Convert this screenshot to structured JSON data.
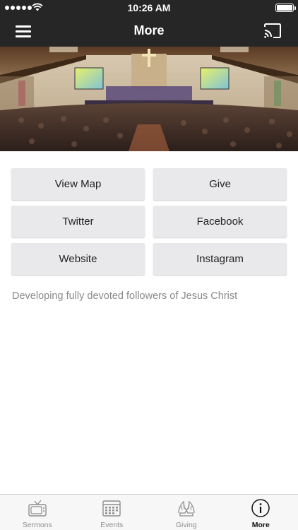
{
  "status_bar": {
    "time": "10:26 AM",
    "signal_icon": "signal-dots-icon",
    "wifi_icon": "wifi-icon",
    "battery_icon": "battery-icon"
  },
  "navbar": {
    "title": "More",
    "menu_icon": "hamburger-menu-icon",
    "cast_icon": "cast-icon"
  },
  "hero": {
    "image": "church-sanctuary-worship-photo"
  },
  "links": [
    "View Map",
    "Give",
    "Twitter",
    "Facebook",
    "Website",
    "Instagram"
  ],
  "tagline": "Developing fully devoted followers of Jesus Christ",
  "tabs": [
    {
      "label": "Sermons",
      "icon": "tv-icon",
      "active": false
    },
    {
      "label": "Events",
      "icon": "calendar-icon",
      "active": false
    },
    {
      "label": "Giving",
      "icon": "praying-hands-icon",
      "active": false
    },
    {
      "label": "More",
      "icon": "info-icon",
      "active": true
    }
  ],
  "colors": {
    "nav_background": "#262626",
    "button_background": "#e9e9eb",
    "tagline_text": "#8a8a8a",
    "tab_inactive": "#8e8e8e",
    "tab_active": "#111111"
  }
}
